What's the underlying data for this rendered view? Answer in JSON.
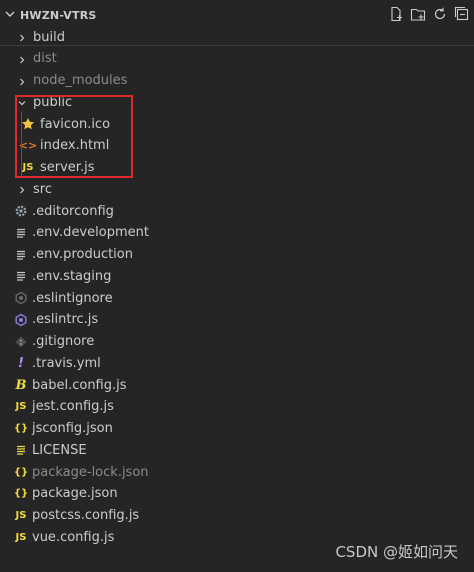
{
  "explorer": {
    "title": "HWZN-VTRS",
    "actions": [
      "new-file-icon",
      "new-folder-icon",
      "refresh-icon",
      "collapse-all-icon"
    ]
  },
  "tree": [
    {
      "label": "build",
      "type": "folder",
      "expanded": false,
      "dim": false
    },
    {
      "label": "dist",
      "type": "folder",
      "expanded": false,
      "dim": true
    },
    {
      "label": "node_modules",
      "type": "folder",
      "expanded": false,
      "dim": true
    },
    {
      "label": "public",
      "type": "folder",
      "expanded": true,
      "dim": false
    },
    {
      "label": "favicon.ico",
      "type": "file",
      "icon": "star-icon",
      "dim": false
    },
    {
      "label": "index.html",
      "type": "file",
      "icon": "html-icon",
      "dim": false
    },
    {
      "label": "server.js",
      "type": "file",
      "icon": "js-icon",
      "dim": false
    },
    {
      "label": "src",
      "type": "folder",
      "expanded": false,
      "dim": false
    },
    {
      "label": ".editorconfig",
      "type": "file",
      "icon": "gear-icon",
      "dim": false
    },
    {
      "label": ".env.development",
      "type": "file",
      "icon": "lines-icon",
      "dim": false
    },
    {
      "label": ".env.production",
      "type": "file",
      "icon": "lines-icon",
      "dim": false
    },
    {
      "label": ".env.staging",
      "type": "file",
      "icon": "lines-icon",
      "dim": false
    },
    {
      "label": ".eslintignore",
      "type": "file",
      "icon": "eslint-icon",
      "dim": false
    },
    {
      "label": ".eslintrc.js",
      "type": "file",
      "icon": "eslint-purple-icon",
      "dim": false
    },
    {
      "label": ".gitignore",
      "type": "file",
      "icon": "git-icon",
      "dim": false
    },
    {
      "label": ".travis.yml",
      "type": "file",
      "icon": "exclamation-icon",
      "dim": false
    },
    {
      "label": "babel.config.js",
      "type": "file",
      "icon": "babel-icon",
      "dim": false
    },
    {
      "label": "jest.config.js",
      "type": "file",
      "icon": "js-icon",
      "dim": false
    },
    {
      "label": "jsconfig.json",
      "type": "file",
      "icon": "braces-icon",
      "dim": false
    },
    {
      "label": "LICENSE",
      "type": "file",
      "icon": "license-icon",
      "dim": false
    },
    {
      "label": "package-lock.json",
      "type": "file",
      "icon": "braces-icon",
      "dim": true
    },
    {
      "label": "package.json",
      "type": "file",
      "icon": "braces-icon",
      "dim": false
    },
    {
      "label": "postcss.config.js",
      "type": "file",
      "icon": "js-icon",
      "dim": false
    },
    {
      "label": "vue.config.js",
      "type": "file",
      "icon": "js-icon",
      "dim": false
    }
  ],
  "watermark": "CSDN @姬如问天",
  "colors": {
    "background": "#252526",
    "highlight_box": "#e02a2a",
    "js": "#f1dd3f",
    "html": "#e37933",
    "star": "#f4c542",
    "eslint_purple": "#8f7ce0",
    "gear": "#9aa6b5"
  }
}
